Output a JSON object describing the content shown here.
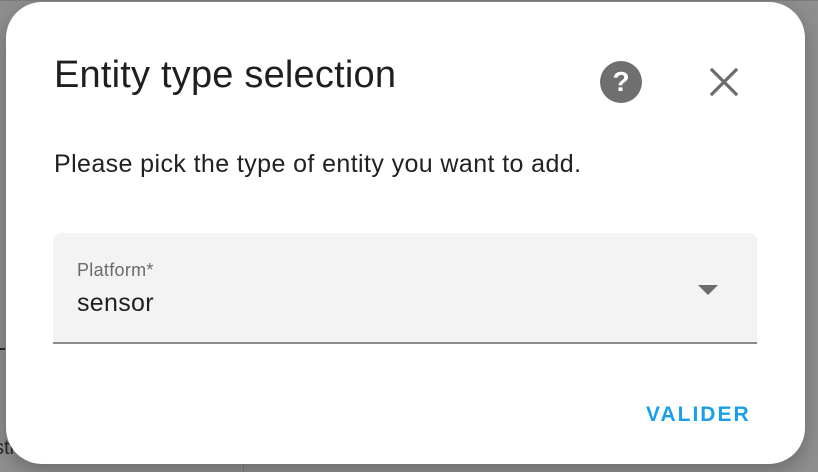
{
  "background": {
    "partial_text": "stre"
  },
  "dialog": {
    "title": "Entity type selection",
    "help_icon": "help-circle-icon",
    "help_glyph": "?",
    "close_icon": "close-icon",
    "description": "Please pick the type of entity you want to add.",
    "platform_select": {
      "label": "Platform*",
      "value": "sensor",
      "arrow_icon": "menu-down-icon"
    },
    "validate_label": "VALIDER"
  },
  "colors": {
    "accent": "#1aa0e8",
    "help_bg": "#6f6f6f",
    "field_bg": "#f3f3f3",
    "backdrop": "#8e8e8e"
  }
}
